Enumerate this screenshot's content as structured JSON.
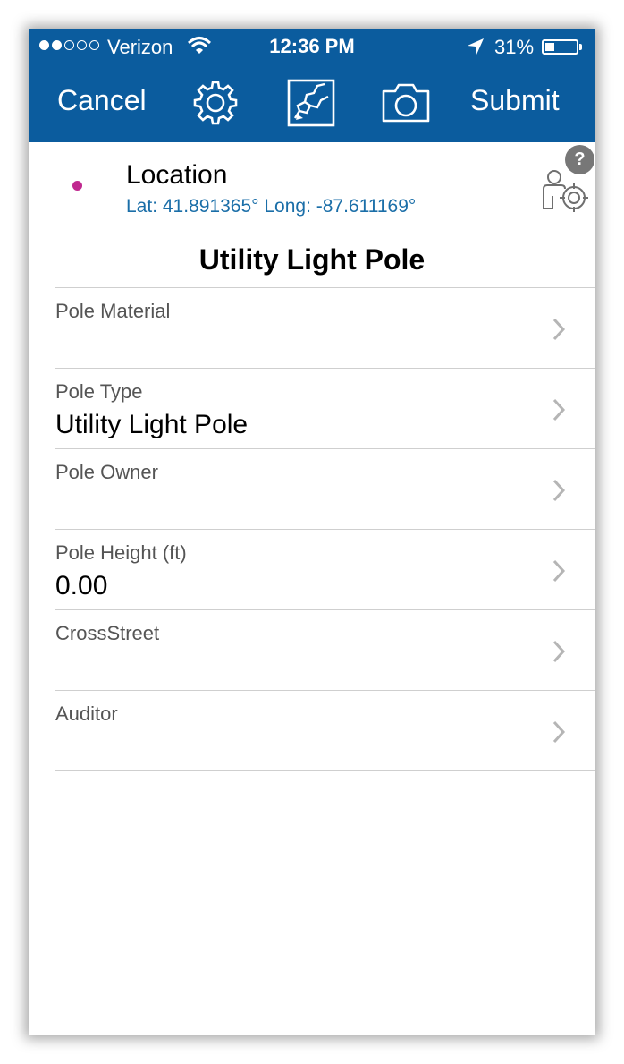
{
  "status_bar": {
    "carrier": "Verizon",
    "time": "12:36 PM",
    "battery": "31%",
    "battery_level": 0.31
  },
  "nav": {
    "cancel_label": "Cancel",
    "submit_label": "Submit",
    "icons": [
      "gear-icon",
      "map-icon",
      "camera-icon"
    ]
  },
  "location": {
    "title": "Location",
    "coords": "Lat: 41.891365° Long: -87.611169°",
    "help": "?"
  },
  "form": {
    "title": "Utility Light Pole",
    "fields": [
      {
        "label": "Pole Material",
        "value": ""
      },
      {
        "label": "Pole Type",
        "value": "Utility Light Pole"
      },
      {
        "label": "Pole Owner",
        "value": ""
      },
      {
        "label": "Pole Height (ft)",
        "value": "0.00"
      },
      {
        "label": "CrossStreet",
        "value": ""
      },
      {
        "label": "Auditor",
        "value": ""
      }
    ]
  },
  "colors": {
    "header": "#0b5c9e",
    "link": "#1a6ea8",
    "marker": "#c0288f"
  }
}
